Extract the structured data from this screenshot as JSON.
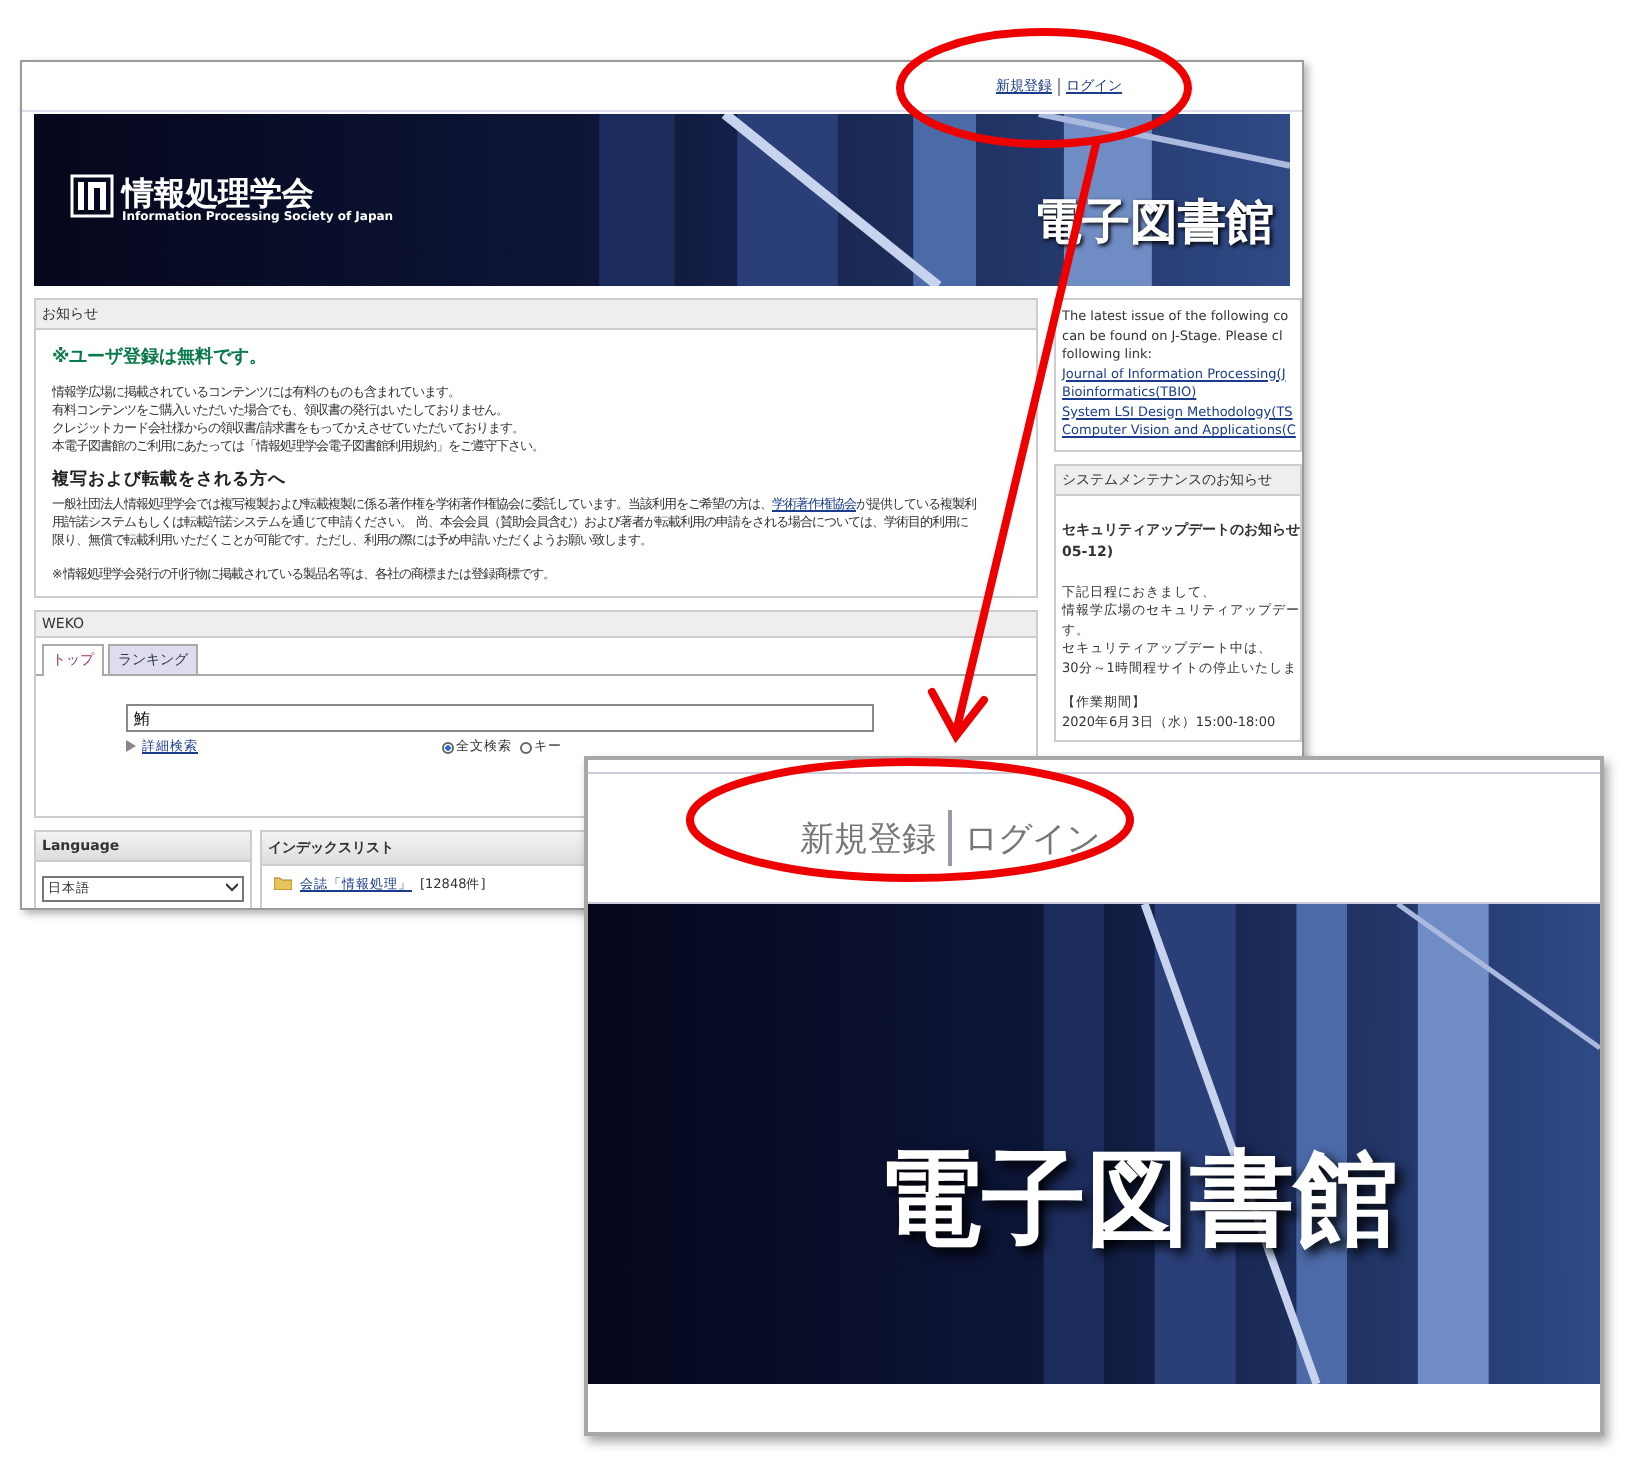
{
  "header_links": [
    {
      "label": "新規登録"
    },
    {
      "label": "ログイン"
    }
  ],
  "banner": {
    "org_name": "情報処理学会",
    "org_name_en": "Information Processing Society of Japan",
    "title": "電子図書館"
  },
  "notice": {
    "heading": "お知らせ",
    "highlight": "※ユーザ登録は無料です。",
    "lines": [
      "情報学広場に掲載されているコンテンツには有料のものも含まれています。",
      "有料コンテンツをご購入いただいた場合でも、領収書の発行はいたしておりません。",
      "クレジットカード会社様からの領収書/請求書をもってかえさせていただいております。",
      "本電子図書館のご利用にあたっては「情報処理学会電子図書館利用規約」をご遵守下さい。"
    ],
    "copy_heading": "複写および転載をされる方へ",
    "copy_text_before": "一般社団法人情報処理学会では複写複製および転載複製に係る著作権を学術著作権協会に委託しています。当該利用をご希望の方は、",
    "copy_link": "学術著作権協会",
    "copy_text_after": "が提供している複製利用許諾システムもしくは転載許諾システムを通じて申請ください。 尚、本会会員（賛助会員含む）および著者が転載利用の申請をされる場合については、学術目的利用に限り、無償で転載利用いただくことが可能です。ただし、利用の際には予め申請いただくようお願い致します。",
    "footnote": "※情報処理学会発行の刊行物に掲載されている製品名等は、各社の商標または登録商標です。"
  },
  "weko": {
    "heading": "WEKO",
    "tabs": [
      {
        "label": "トップ",
        "selected": true
      },
      {
        "label": "ランキング",
        "selected": false
      }
    ],
    "search_value": "鮪",
    "advanced_link": "詳細検索",
    "search_modes": [
      {
        "label": "全文検索",
        "selected": true
      },
      {
        "label": "キー",
        "selected": false
      }
    ]
  },
  "language": {
    "heading": "Language",
    "value": "日本語"
  },
  "index_list": {
    "heading": "インデックスリスト",
    "items": [
      {
        "label": "会誌「情報処理」",
        "count": "[12848件]"
      }
    ]
  },
  "jstage": {
    "lines": [
      "The latest issue of the following co",
      "can be found on J-Stage.  Please cl",
      "following link:"
    ],
    "links": [
      "Journal of Information Processing(J",
      "Bioinformatics(TBIO)",
      "System LSI Design Methodology(TS",
      "Computer Vision and Applications(C"
    ]
  },
  "maintenance": {
    "heading": "システムメンテナンスのお知らせ",
    "title_lines": [
      "セキュリティアップデートのお知らせ",
      "05-12)"
    ],
    "body_lines": [
      "下記日程におきまして、",
      "情報学広場のセキュリティアップデー",
      "す。",
      "セキュリティアップデート中は、",
      "30分～1時間程サイトの停止いたしま"
    ],
    "period_heading": "【作業期間】",
    "period": "2020年6月3日（水）15:00-18:00"
  },
  "inset": {
    "header_links": [
      {
        "label": "新規登録"
      },
      {
        "label": "ログイン"
      }
    ],
    "banner_title": "電子図書館"
  }
}
